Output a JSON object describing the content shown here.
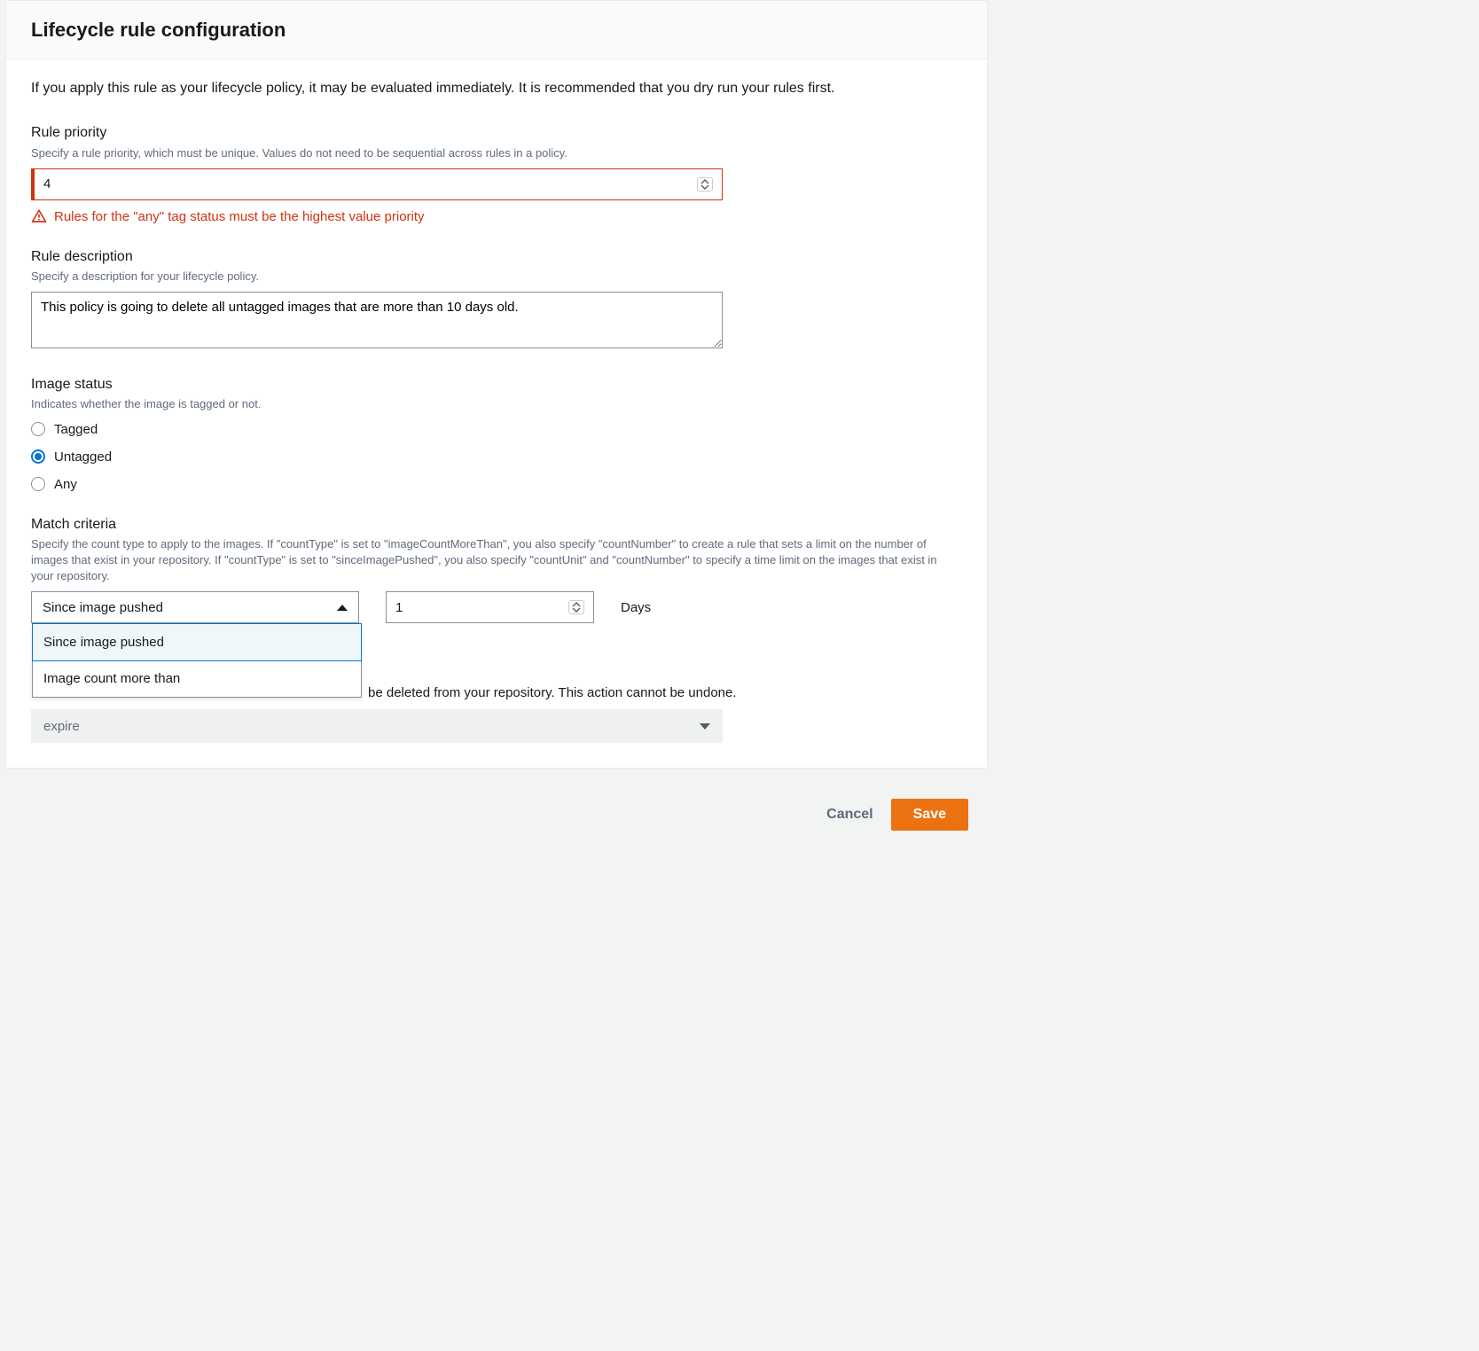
{
  "header": {
    "title": "Lifecycle rule configuration"
  },
  "intro": "If you apply this rule as your lifecycle policy, it may be evaluated immediately. It is recommended that you dry run your rules first.",
  "priority": {
    "label": "Rule priority",
    "hint": "Specify a rule priority, which must be unique. Values do not need to be sequential across rules in a policy.",
    "value": "4",
    "error": "Rules for the \"any\" tag status must be the highest value priority"
  },
  "description": {
    "label": "Rule description",
    "hint": "Specify a description for your lifecycle policy.",
    "value": "This policy is going to delete all untagged images that are more than 10 days old."
  },
  "imageStatus": {
    "label": "Image status",
    "hint": "Indicates whether the image is tagged or not.",
    "options": {
      "tagged": "Tagged",
      "untagged": "Untagged",
      "any": "Any"
    }
  },
  "matchCriteria": {
    "label": "Match criteria",
    "hint": "Specify the count type to apply to the images. If \"countType\" is set to \"imageCountMoreThan\", you also specify \"countNumber\" to create a rule that sets a limit on the number of images that exist in your repository. If \"countType\" is set to \"sinceImagePushed\", you also specify \"countUnit\" and \"countNumber\" to specify a time limit on the images that exist in your repository.",
    "selectValue": "Since image pushed",
    "dropdownOptions": {
      "opt1": "Since image pushed",
      "opt2": "Image count more than"
    },
    "countValue": "1",
    "unitLabel": "Days"
  },
  "ruleAction": {
    "hintSuffix": "be deleted from your repository. This action cannot be undone.",
    "value": "expire"
  },
  "footer": {
    "cancel": "Cancel",
    "save": "Save"
  }
}
